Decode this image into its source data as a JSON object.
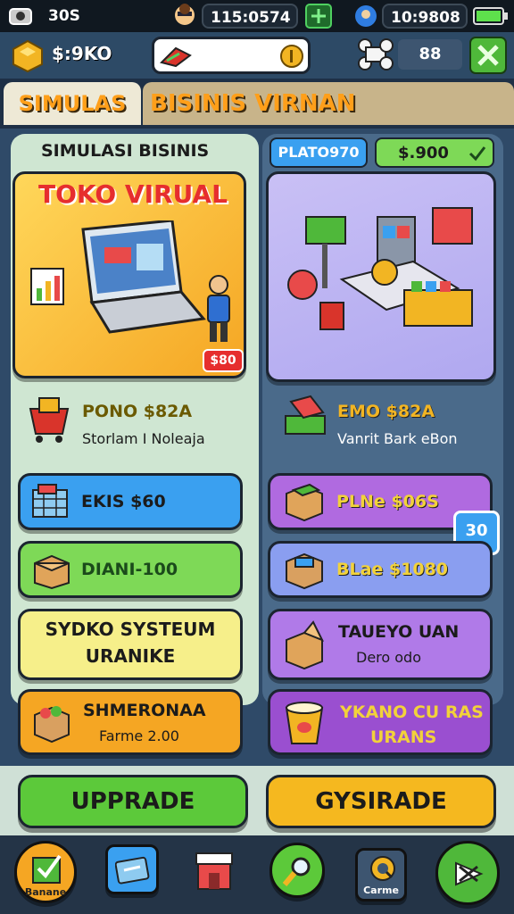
{
  "status": {
    "left_value": "30S",
    "time": "115:0574",
    "right_value": "10:9808",
    "battery_icon": "battery-icon",
    "plus_icon": "plus-icon"
  },
  "topbar": {
    "money": "$:9KO",
    "input_placeholder": "",
    "badge_count": "88"
  },
  "tabs": [
    {
      "label": "SIMULAS",
      "active": true
    },
    {
      "label": "BISINIS VIRNAN",
      "active": false
    }
  ],
  "left": {
    "section_title": "SIMULASI BISINIS",
    "banner_title": "TOKO VIRUAL",
    "banner_badge": "$80",
    "info_label": "PONO $82A",
    "info_sub": "Storlam I Noleaja",
    "cards": [
      {
        "label": "EKIS $60"
      },
      {
        "label": "DIANI-100"
      },
      {
        "line1": "SYDKO  SYSTEUM",
        "line2": "URANIKE"
      },
      {
        "label": "SHMERONAA",
        "sub": "Farme 2.00"
      }
    ]
  },
  "right": {
    "chip_blue": "PLATO970",
    "chip_green": "$.900",
    "info_label": "EMO $82A",
    "info_sub": "Vanrit Bark eBon",
    "side_badge": "30",
    "cards": [
      {
        "label": "PLNe $06S"
      },
      {
        "label": "BLae $1080"
      },
      {
        "label": "TAUEYO UAN",
        "sub": "Dero odo"
      },
      {
        "line1": "YKANO CU RAS",
        "line2": "URANS"
      }
    ]
  },
  "buttons": {
    "upgrade": "UPPRADE",
    "gysirade": "GYSIRADE"
  },
  "nav": {
    "first_label": "Banane",
    "fifth_label": "Carme"
  },
  "colors": {
    "accent_orange": "#ff9f1a",
    "green": "#7ed957",
    "blue": "#3aa0f0",
    "purple": "#a46ae0",
    "yellow": "#f6d94a"
  }
}
